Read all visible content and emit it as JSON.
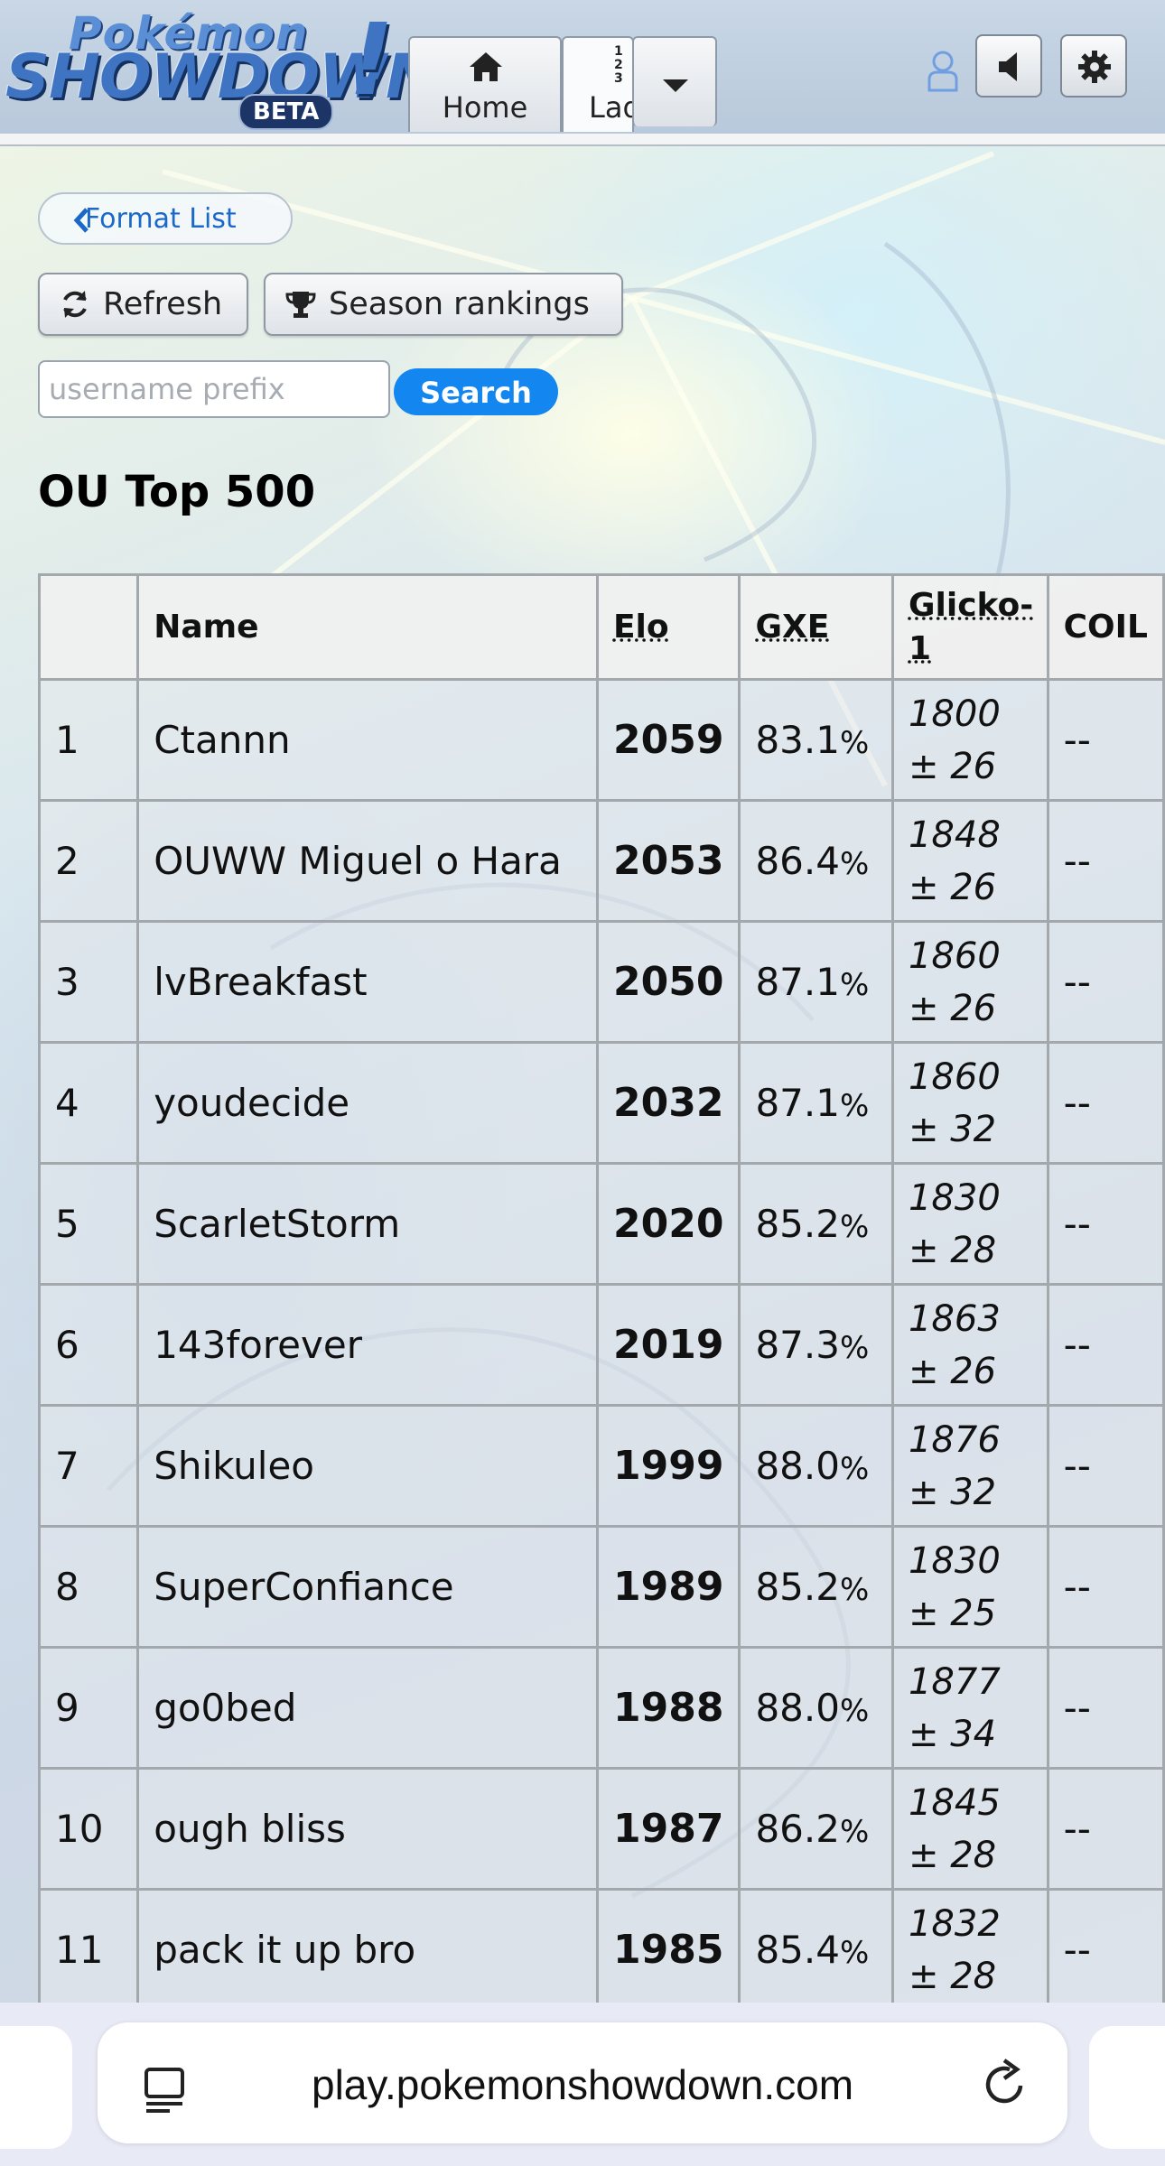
{
  "header": {
    "logo": {
      "top": "Pokémon",
      "main": "SHOWDOWN",
      "bang": "!",
      "badge": "BETA"
    },
    "tabs": [
      {
        "label": "Home",
        "icon": "home-icon"
      },
      {
        "label": "Ladder",
        "icon": "ranking-numbers-icon",
        "numbers": [
          "1",
          "2",
          "3"
        ]
      }
    ],
    "buttons": [
      "user-icon",
      "volume-icon",
      "gear-icon"
    ]
  },
  "controls": {
    "format_list": "Format List",
    "refresh": "Refresh",
    "season_rankings": "Season rankings",
    "search_placeholder": "username prefix",
    "search_button": "Search"
  },
  "page_title": "OU Top 500",
  "table": {
    "headers": {
      "rank": "",
      "name": "Name",
      "elo": "Elo",
      "gxe": "GXE",
      "glicko": "Glicko-1",
      "coil": "COIL"
    },
    "rows": [
      {
        "rank": "1",
        "name": "Ctannn",
        "elo": "2059",
        "gxe": "83.1",
        "glicko": "1800",
        "dev": "± 26",
        "coil": "--"
      },
      {
        "rank": "2",
        "name": "OUWW Miguel o Hara",
        "elo": "2053",
        "gxe": "86.4",
        "glicko": "1848",
        "dev": "± 26",
        "coil": "--"
      },
      {
        "rank": "3",
        "name": "lvBreakfast",
        "elo": "2050",
        "gxe": "87.1",
        "glicko": "1860",
        "dev": "± 26",
        "coil": "--"
      },
      {
        "rank": "4",
        "name": "youdecide",
        "elo": "2032",
        "gxe": "87.1",
        "glicko": "1860",
        "dev": "± 32",
        "coil": "--"
      },
      {
        "rank": "5",
        "name": "ScarletStorm",
        "elo": "2020",
        "gxe": "85.2",
        "glicko": "1830",
        "dev": "± 28",
        "coil": "--"
      },
      {
        "rank": "6",
        "name": "143forever",
        "elo": "2019",
        "gxe": "87.3",
        "glicko": "1863",
        "dev": "± 26",
        "coil": "--"
      },
      {
        "rank": "7",
        "name": "Shikuleo",
        "elo": "1999",
        "gxe": "88.0",
        "glicko": "1876",
        "dev": "± 32",
        "coil": "--"
      },
      {
        "rank": "8",
        "name": "SuperConfiance",
        "elo": "1989",
        "gxe": "85.2",
        "glicko": "1830",
        "dev": "± 25",
        "coil": "--"
      },
      {
        "rank": "9",
        "name": "go0bed",
        "elo": "1988",
        "gxe": "88.0",
        "glicko": "1877",
        "dev": "± 34",
        "coil": "--"
      },
      {
        "rank": "10",
        "name": "ough bliss",
        "elo": "1987",
        "gxe": "86.2",
        "glicko": "1845",
        "dev": "± 28",
        "coil": "--"
      },
      {
        "rank": "11",
        "name": "pack it up bro",
        "elo": "1985",
        "gxe": "85.4",
        "glicko": "1832",
        "dev": "± 28",
        "coil": "--"
      }
    ],
    "percent_sign": "%"
  },
  "browser": {
    "url": "play.pokemonshowdown.com"
  },
  "colors": {
    "accent_blue": "#1386f0",
    "link_blue": "#1a69c8"
  }
}
